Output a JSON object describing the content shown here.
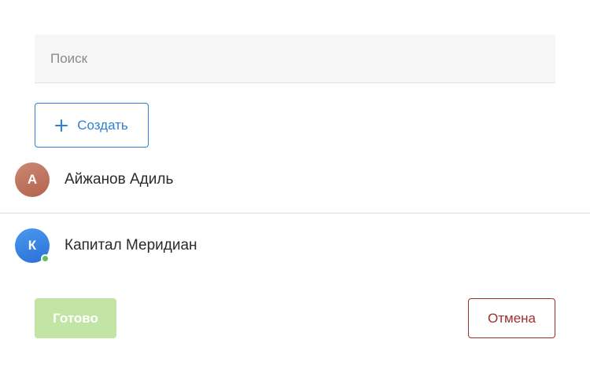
{
  "search": {
    "placeholder": "Поиск",
    "value": ""
  },
  "create_button": {
    "label": "Создать",
    "icon": "plus-icon",
    "color": "#2f7fd8"
  },
  "contacts": [
    {
      "initial": "А",
      "name": "Айжанов Адиль",
      "online": false
    },
    {
      "initial": "К",
      "name": "Капитал Меридиан",
      "online": true
    }
  ],
  "footer": {
    "done_label": "Готово",
    "cancel_label": "Отмена",
    "done_color": "#c2e4a4",
    "cancel_color": "#9c2f2f"
  }
}
